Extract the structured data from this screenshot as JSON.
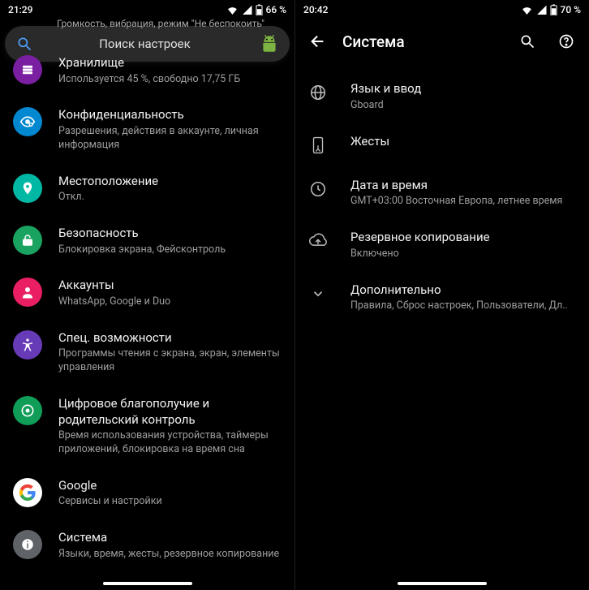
{
  "left": {
    "status": {
      "time": "21:29",
      "battery": "66 %"
    },
    "truncated_subtitle": "Громкость, вибрация, режим \"Не беспокоить\"",
    "search_placeholder": "Поиск настроек",
    "items": [
      {
        "title": "Хранилище",
        "sub": "Используется 45 %, свободно 17,75 ГБ",
        "bg": "bg-purple",
        "icon": "storage-icon"
      },
      {
        "title": "Конфиденциальность",
        "sub": "Разрешения, действия в аккаунте, личная информация",
        "bg": "bg-grayblue",
        "icon": "privacy-icon"
      },
      {
        "title": "Местоположение",
        "sub": "Откл.",
        "bg": "bg-teal",
        "icon": "location-icon"
      },
      {
        "title": "Безопасность",
        "sub": "Блокировка экрана, Фейсконтроль",
        "bg": "bg-green",
        "icon": "security-icon"
      },
      {
        "title": "Аккаунты",
        "sub": "WhatsApp, Google и Duo",
        "bg": "bg-pink",
        "icon": "accounts-icon"
      },
      {
        "title": "Спец. возможности",
        "sub": "Программы чтения с экрана, экран, элементы управления",
        "bg": "bg-violet",
        "icon": "accessibility-icon"
      },
      {
        "title": "Цифровое благополучие и родительский контроль",
        "sub": "Время использования устройства, таймеры приложений, блокировка на время сна",
        "bg": "bg-green2",
        "icon": "wellbeing-icon"
      },
      {
        "title": "Google",
        "sub": "Сервисы и настройки",
        "bg": "bg-white",
        "icon": "google-icon"
      },
      {
        "title": "Система",
        "sub": "Языки, время, жесты, резервное копирование",
        "bg": "bg-gray",
        "icon": "system-icon"
      }
    ]
  },
  "right": {
    "status": {
      "time": "20:42",
      "battery": "70 %"
    },
    "title": "Система",
    "items": [
      {
        "title": "Язык и ввод",
        "sub": "Gboard",
        "icon": "language-icon"
      },
      {
        "title": "Жесты",
        "sub": "",
        "icon": "gestures-icon"
      },
      {
        "title": "Дата и время",
        "sub": "GMT+03:00 Восточная Европа, летнее время",
        "icon": "clock-icon"
      },
      {
        "title": "Резервное копирование",
        "sub": "Включено",
        "icon": "backup-icon"
      },
      {
        "title": "Дополнительно",
        "sub": "Правила, Сброс настроек, Пользователи, Дл..",
        "icon": "expand-icon"
      }
    ]
  }
}
